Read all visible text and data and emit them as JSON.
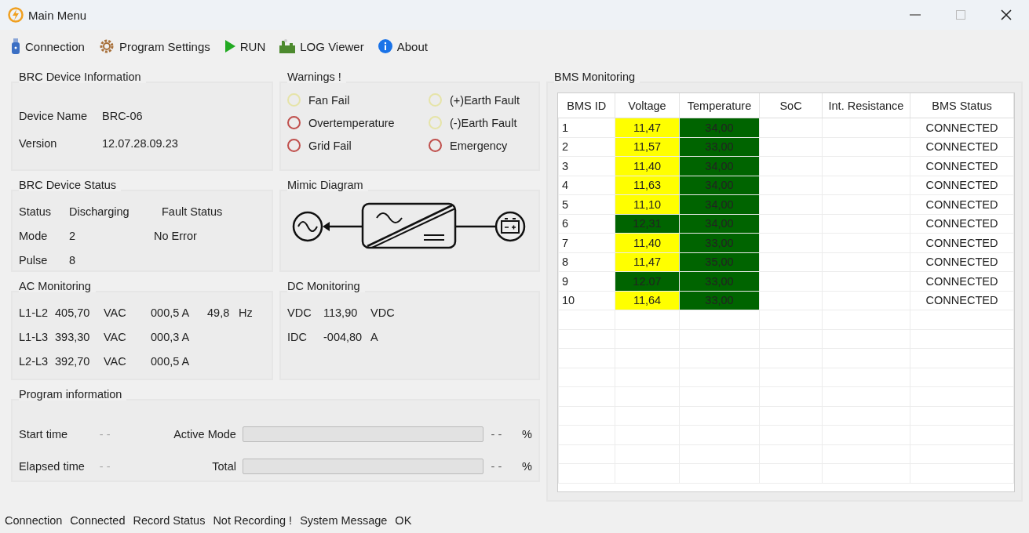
{
  "window": {
    "title": "Main Menu"
  },
  "toolbar": [
    {
      "kind": "usb",
      "label": "Connection"
    },
    {
      "kind": "gear",
      "label": "Program Settings"
    },
    {
      "kind": "play",
      "label": "RUN"
    },
    {
      "kind": "log",
      "label": "LOG Viewer"
    },
    {
      "kind": "info",
      "label": "About"
    }
  ],
  "device_information": {
    "title": "BRC Device Information",
    "fields": [
      {
        "label": "Device Name",
        "value": "BRC-06"
      },
      {
        "label": "Version",
        "value": "12.07.28.09.23"
      }
    ]
  },
  "warnings": {
    "title": "Warnings !",
    "items": [
      {
        "label": "Fan Fail",
        "color": "#e6e4a8"
      },
      {
        "label": "(+)Earth Fault",
        "color": "#e6e4a8"
      },
      {
        "label": "Overtemperature",
        "color": "#c0504d"
      },
      {
        "label": "(-)Earth Fault",
        "color": "#e6e4a8"
      },
      {
        "label": "Grid Fail",
        "color": "#c0504d"
      },
      {
        "label": "Emergency",
        "color": "#c0504d"
      }
    ]
  },
  "device_status": {
    "title": "BRC Device Status",
    "status_label": "Status",
    "status_value": "Discharging",
    "fault_label": "Fault Status",
    "mode_label": "Mode",
    "mode_value": "2",
    "fault_value": "No Error",
    "pulse_label": "Pulse",
    "pulse_value": "8"
  },
  "mimic_diagram": {
    "title": "Mimic Diagram"
  },
  "ac_monitoring": {
    "title": "AC Monitoring",
    "rows": [
      {
        "line": "L1-L2",
        "voltage": "405,70",
        "voltage_unit": "VAC",
        "current": "000,5 A",
        "frequency": "49,8",
        "frequency_unit": "Hz"
      },
      {
        "line": "L1-L3",
        "voltage": "393,30",
        "voltage_unit": "VAC",
        "current": "000,3 A"
      },
      {
        "line": "L2-L3",
        "voltage": "392,70",
        "voltage_unit": "VAC",
        "current": "000,5 A"
      }
    ]
  },
  "dc_monitoring": {
    "title": "DC Monitoring",
    "rows": [
      {
        "label": "VDC",
        "value": "113,90",
        "unit": "VDC"
      },
      {
        "label": "IDC",
        "value": "-004,80",
        "unit": "A"
      }
    ]
  },
  "program_information": {
    "title": "Program information",
    "rows": [
      {
        "label": "Start time",
        "value": "- -",
        "bar_label": "Active Mode",
        "level": 0,
        "percent": "- -",
        "unit": "%"
      },
      {
        "label": "Elapsed time",
        "value": "- -",
        "bar_label": "Total",
        "level": 0,
        "percent": "- -",
        "unit": "%"
      }
    ]
  },
  "bms_monitoring": {
    "title": "BMS Monitoring",
    "table": {
      "columns": [
        "BMS ID",
        "Voltage",
        "Temperature",
        "SoC",
        "Int. Resistance",
        "BMS Status"
      ],
      "rows": [
        {
          "id": "1",
          "voltage": {
            "text": "11,47",
            "color": "#ffff00"
          },
          "temperature": {
            "text": "34,00",
            "color": "#006400"
          },
          "status": "CONNECTED"
        },
        {
          "id": "2",
          "voltage": {
            "text": "11,57",
            "color": "#ffff00"
          },
          "temperature": {
            "text": "33,00",
            "color": "#006400"
          },
          "status": "CONNECTED"
        },
        {
          "id": "3",
          "voltage": {
            "text": "11,40",
            "color": "#ffff00"
          },
          "temperature": {
            "text": "34,00",
            "color": "#006400"
          },
          "status": "CONNECTED"
        },
        {
          "id": "4",
          "voltage": {
            "text": "11,63",
            "color": "#ffff00"
          },
          "temperature": {
            "text": "34,00",
            "color": "#006400"
          },
          "status": "CONNECTED"
        },
        {
          "id": "5",
          "voltage": {
            "text": "11,10",
            "color": "#ffff00"
          },
          "temperature": {
            "text": "34,00",
            "color": "#006400"
          },
          "status": "CONNECTED"
        },
        {
          "id": "6",
          "voltage": {
            "text": "12,31",
            "color": "#006400"
          },
          "temperature": {
            "text": "34,00",
            "color": "#006400"
          },
          "status": "CONNECTED"
        },
        {
          "id": "7",
          "voltage": {
            "text": "11,40",
            "color": "#ffff00"
          },
          "temperature": {
            "text": "33,00",
            "color": "#006400"
          },
          "status": "CONNECTED"
        },
        {
          "id": "8",
          "voltage": {
            "text": "11,47",
            "color": "#ffff00"
          },
          "temperature": {
            "text": "35,00",
            "color": "#006400"
          },
          "status": "CONNECTED"
        },
        {
          "id": "9",
          "voltage": {
            "text": "12.07",
            "color": "#006400"
          },
          "temperature": {
            "text": "33,00",
            "color": "#006400"
          },
          "status": "CONNECTED"
        },
        {
          "id": "10",
          "voltage": {
            "text": "11,64",
            "color": "#ffff00"
          },
          "temperature": {
            "text": "33,00",
            "color": "#006400"
          },
          "status": "CONNECTED"
        }
      ]
    }
  },
  "status_bar": [
    {
      "label": "Connection",
      "value": "Connected"
    },
    {
      "label": "Record Status",
      "value": "Not Recording !"
    },
    {
      "label": "System Message",
      "value": "OK"
    }
  ]
}
